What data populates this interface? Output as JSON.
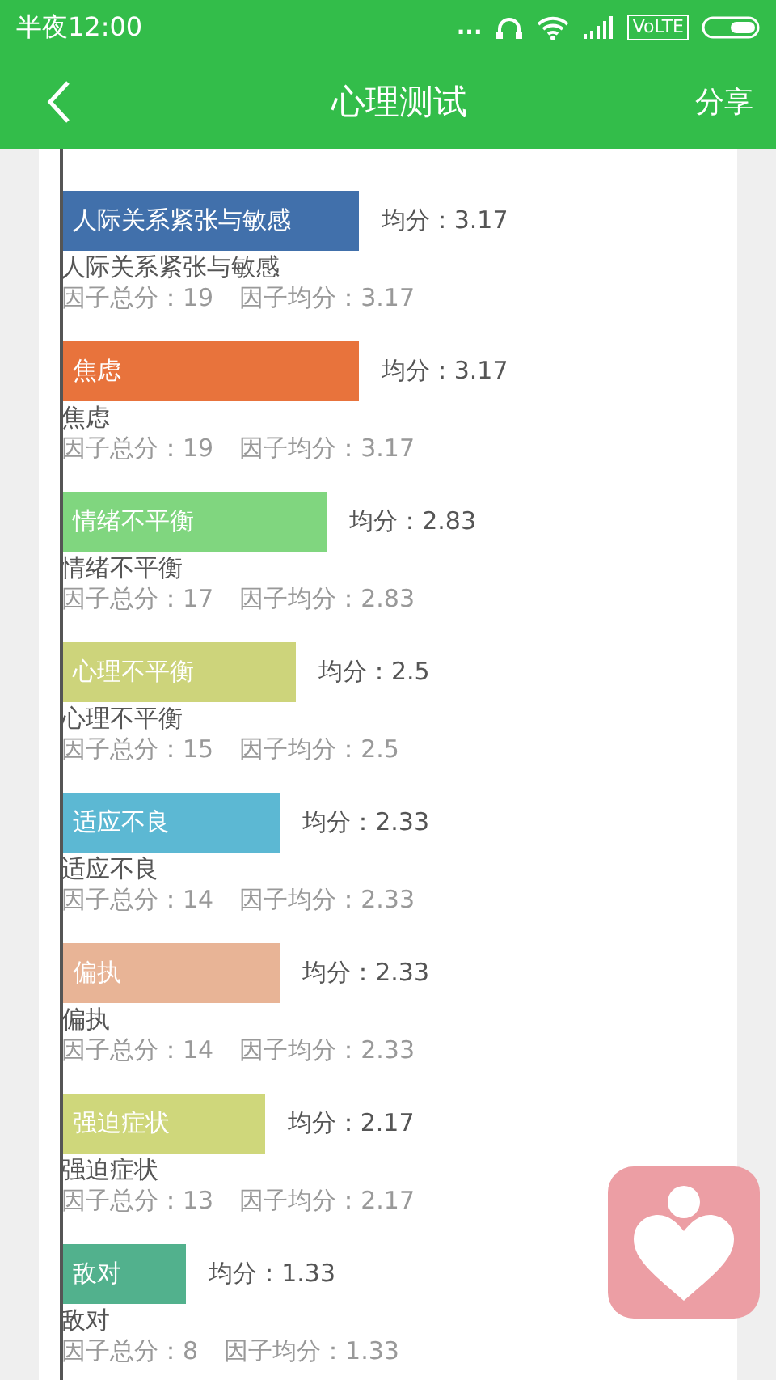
{
  "status_bar": {
    "time": "半夜12:00",
    "dots": "...",
    "network": "VoLTE"
  },
  "header": {
    "title": "心理测试",
    "share": "分享"
  },
  "factors": [
    {
      "name": "人际关系紧张与敏感",
      "color": "#4170ab",
      "score": "均分：3.17",
      "label": "人际关系紧张与敏感",
      "total": "因子总分：19",
      "average": "因子均分：3.17"
    },
    {
      "name": "焦虑",
      "color": "#e8733c",
      "score": "均分：3.17",
      "label": "焦虑",
      "total": "因子总分：19",
      "average": "因子均分：3.17"
    },
    {
      "name": "情绪不平衡",
      "color": "#80d67f",
      "score": "均分：2.83",
      "label": "情绪不平衡",
      "total": "因子总分：17",
      "average": "因子均分：2.83"
    },
    {
      "name": "心理不平衡",
      "color": "#cdd47b",
      "score": "均分：2.5",
      "label": "心理不平衡",
      "total": "因子总分：15",
      "average": "因子均分：2.5"
    },
    {
      "name": "适应不良",
      "color": "#5cb8d3",
      "score": "均分：2.33",
      "label": "适应不良",
      "total": "因子总分：14",
      "average": "因子均分：2.33"
    },
    {
      "name": "偏执",
      "color": "#e8b496",
      "score": "均分：2.33",
      "label": "偏执",
      "total": "因子总分：14",
      "average": "因子均分：2.33"
    },
    {
      "name": "强迫症状",
      "color": "#cfd77b",
      "score": "均分：2.17",
      "label": "强迫症状",
      "total": "因子总分：13",
      "average": "因子均分：2.17"
    },
    {
      "name": "敌对",
      "color": "#52b18d",
      "score": "均分：1.33",
      "label": "敌对",
      "total": "因子总分：8",
      "average": "因子均分：1.33"
    }
  ]
}
